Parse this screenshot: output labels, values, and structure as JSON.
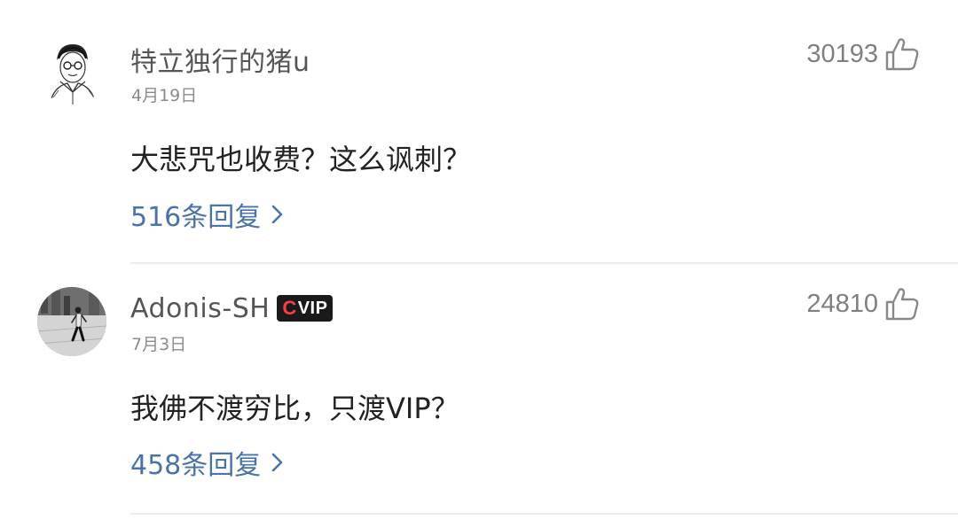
{
  "comments": [
    {
      "username": "特立独行的猪u",
      "date": "4月19日",
      "likes": "30193",
      "content": "大悲咒也收费？这么讽刺？",
      "replies": "516条回复",
      "avatar_icon": "sketch-portrait-avatar",
      "like_icon": "thumbs-up-icon"
    },
    {
      "username": "Adonis-SH",
      "vip_badge": "VIP",
      "vip_badge_prefix": "C",
      "date": "7月3日",
      "likes": "24810",
      "content": "我佛不渡穷比，只渡VIP？",
      "replies": "458条回复",
      "avatar_icon": "photo-avatar",
      "like_icon": "thumbs-up-icon"
    }
  ],
  "colors": {
    "reply_link": "#4a73a8",
    "username": "#555555",
    "content": "#222222",
    "vip_badge_bg": "#1a1a1a",
    "vip_accent": "#ff3b4a"
  }
}
